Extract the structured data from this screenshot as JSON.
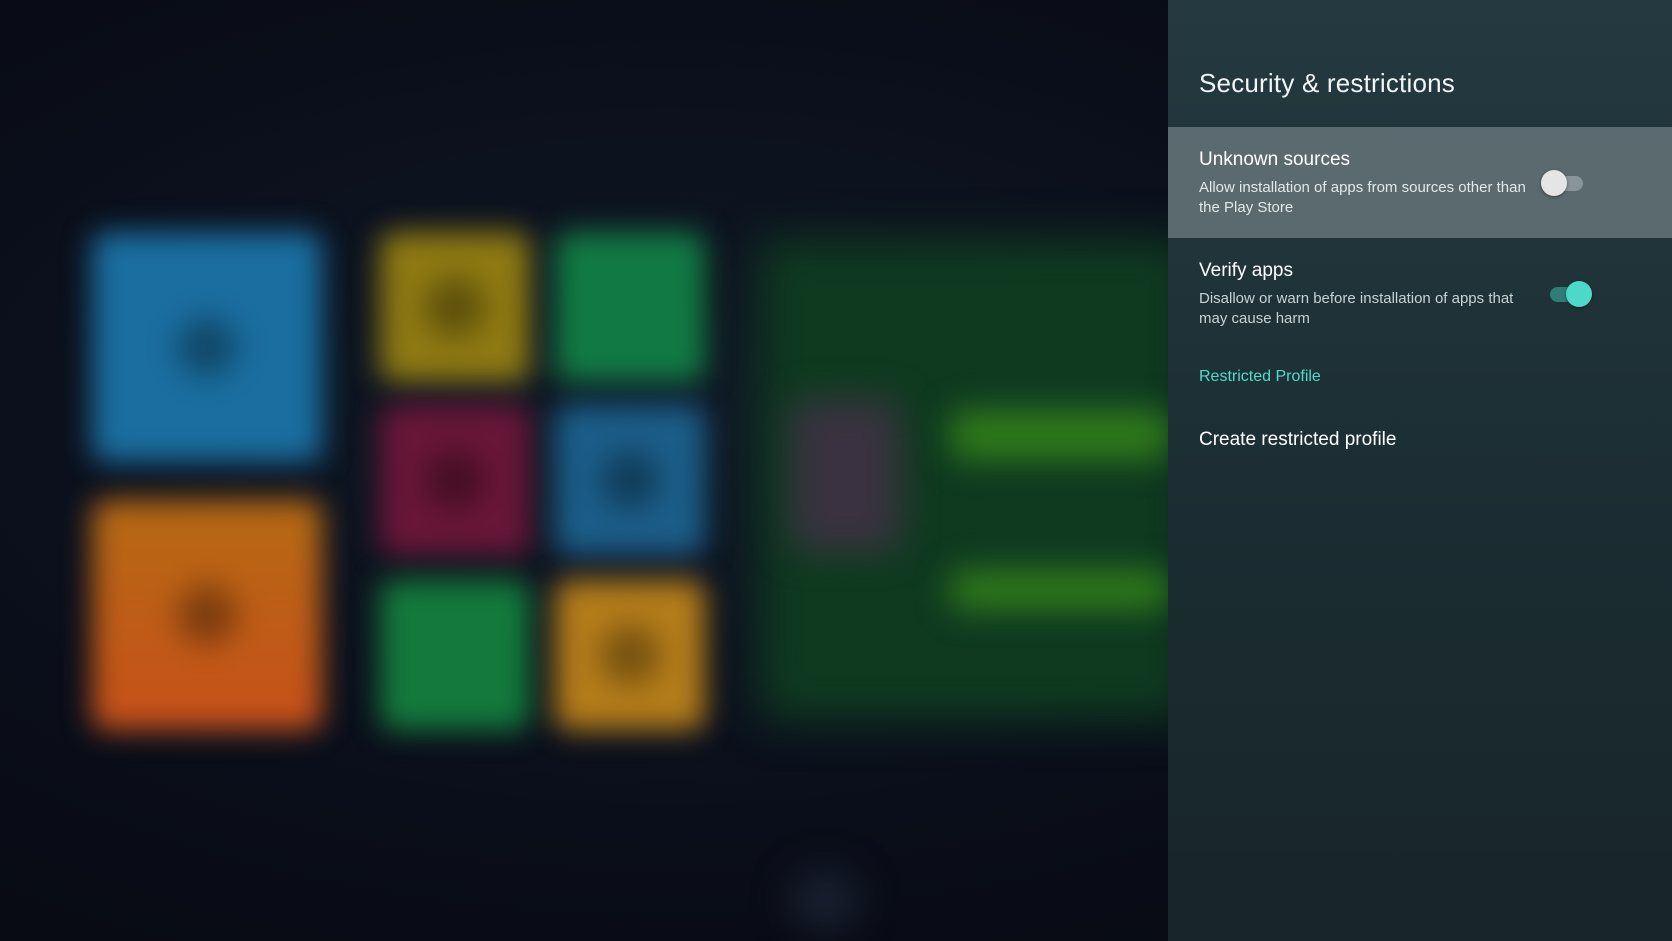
{
  "panel": {
    "title": "Security & restrictions",
    "items": [
      {
        "title": "Unknown sources",
        "subtitle": "Allow installation of apps from sources other than the Play Store",
        "toggle_on": false,
        "focused": true
      },
      {
        "title": "Verify apps",
        "subtitle": "Disallow or warn before installation of apps that may cause harm",
        "toggle_on": true,
        "focused": false
      }
    ],
    "section_header": "Restricted Profile",
    "actions": [
      {
        "label": "Create restricted profile"
      }
    ]
  },
  "colors": {
    "panel_background": "#1f3237",
    "focused_row": "#5a6a6e",
    "accent": "#4ddcc7",
    "toggle_on_thumb": "#4dd9c9",
    "toggle_on_track": "#2f7d78",
    "toggle_off_thumb": "#e4e6e6",
    "toggle_off_track": "#8a9496"
  }
}
